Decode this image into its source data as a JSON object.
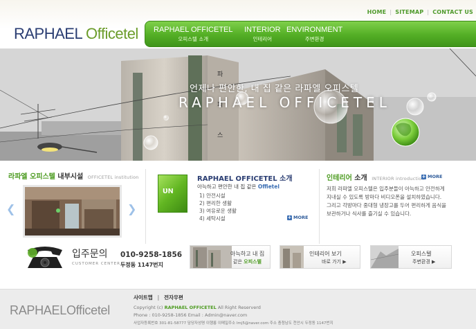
{
  "top_links": {
    "home": "HOME",
    "sitemap": "SITEMAP",
    "contact": "CONTACT US"
  },
  "logo": {
    "part1": "RAPHAEL",
    "part2": "Officetel"
  },
  "nav": [
    {
      "en": "RAPHAEL OFFICETEL",
      "ko": "오피스텔 소개"
    },
    {
      "en": "INTERIOR",
      "ko": "인테리어"
    },
    {
      "en": "ENVIRONMENT",
      "ko": "주변환경"
    }
  ],
  "hero": {
    "tagline": "언제나 편안한, 내 집 같은 라파엘 오피스텔",
    "title": "RAPHAEL OFFICETEL",
    "sign": [
      "파",
      "피",
      "스"
    ]
  },
  "facility": {
    "title_green": "라파엘 오피스텔",
    "title_dark": "내부시설",
    "subtitle": "OFFICETEL institution"
  },
  "office": {
    "title": "RAPHAEL OFFICETEL 소개",
    "subtitle_prefix": "아늑하고 편안한 내 집 같은",
    "subtitle_highlight": "Offietel",
    "items": [
      "1) 안전시설",
      "2) 편리한 생활",
      "3) 여유로운 생활",
      "4) 세탁시설"
    ],
    "more": "MORE",
    "box_label": "ᴜɴ"
  },
  "interior": {
    "title_green": "인테리어",
    "title_dark": "소개",
    "subtitle": "INTERIOR introduction",
    "more": "MORE",
    "text_lines": [
      "저희 라파엘 오피스텔은 입주분들이 아늑하고 안전하게",
      "지내실 수 있도록 방마다 비디오폰을 설치하였습니다.",
      "그리고 각방마다 중대형 냉장고를 두어 편리하게 음식을",
      "보관하거나 식사를 즐기실 수 있습니다."
    ]
  },
  "contact": {
    "title": "입주문의",
    "subtitle": "CUSTOMER CENTER",
    "phone": "010-9258-1856",
    "address": "두정동 1147번지"
  },
  "banners": [
    {
      "line1": "아늑하고 내 집",
      "line2_prefix": "같은",
      "line2_highlight": "오피스텔"
    },
    {
      "line1": "인테리어 보기",
      "line2_prefix": "바로 가기 ▶",
      "line2_highlight": ""
    },
    {
      "line1": "오피스텔",
      "line2_prefix": "주변환경 ▶",
      "line2_highlight": ""
    }
  ],
  "footer": {
    "logo_part1": "RAPHAEL",
    "logo_part2": "Officetel",
    "link_sitemap": "사이트맵",
    "link_privacy": "전자우편",
    "copy_prefix": "Copyright (c)",
    "copy_highlight": "RAPHAEL OFFICETEL",
    "copy_suffix": "All Right Reserverd",
    "contact_line": "Phone : 010-9258-1856  Email : Admin@naver.com",
    "biz_line": "사업자등록번호 301-81-58777 담당자성명 이행릉 이메일주소 lmj5@naver.com  주소 충청남도 천안시 두정동 1147번지"
  },
  "colors": {
    "brand_green": "#53ae25",
    "brand_navy": "#2a3d72",
    "link_blue": "#3c6fb4"
  }
}
